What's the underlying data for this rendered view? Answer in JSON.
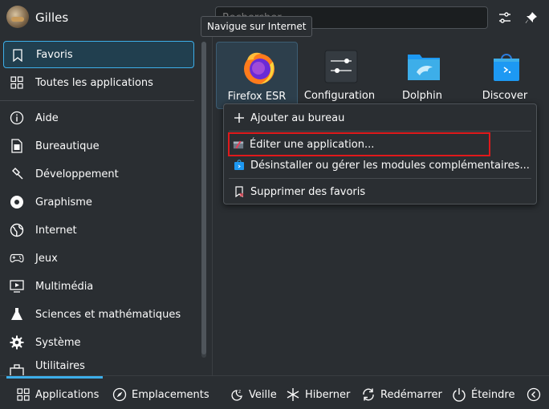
{
  "header": {
    "username": "Gilles",
    "search_placeholder": "Rechercher...",
    "settings_icon": "sliders-icon",
    "pin_icon": "pin-icon"
  },
  "tooltip": "Navigue sur Internet",
  "sidebar": {
    "top_items": [
      {
        "label": "Favoris",
        "icon": "bookmark-icon",
        "active": true
      },
      {
        "label": "Toutes les applications",
        "icon": "grid-icon"
      }
    ],
    "categories": [
      {
        "label": "Aide",
        "icon": "info-icon"
      },
      {
        "label": "Bureautique",
        "icon": "office-icon"
      },
      {
        "label": "Développement",
        "icon": "hammer-icon"
      },
      {
        "label": "Graphisme",
        "icon": "palette-icon"
      },
      {
        "label": "Internet",
        "icon": "globe-icon"
      },
      {
        "label": "Jeux",
        "icon": "gamepad-icon"
      },
      {
        "label": "Multimédia",
        "icon": "media-icon"
      },
      {
        "label": "Sciences et mathématiques",
        "icon": "flask-icon"
      },
      {
        "label": "Système",
        "icon": "gear-icon"
      },
      {
        "label": "Utilitaires",
        "icon": "toolbox-icon"
      }
    ]
  },
  "favorites": [
    {
      "label": "Firefox ESR",
      "icon": "firefox-icon"
    },
    {
      "label": "Configuration",
      "icon": "configuration-icon"
    },
    {
      "label": "Dolphin",
      "icon": "dolphin-folder-icon"
    },
    {
      "label": "Discover",
      "icon": "discover-bag-icon"
    }
  ],
  "context_menu": {
    "items": [
      {
        "label": "Ajouter au bureau",
        "icon": "plus-icon"
      },
      {
        "label": "Éditer une application...",
        "icon": "edit-app-icon",
        "highlighted": true
      },
      {
        "label": "Désinstaller ou gérer les modules complémentaires...",
        "icon": "discover-small-icon"
      },
      {
        "label": "Supprimer des favoris",
        "icon": "remove-bookmark-icon"
      }
    ]
  },
  "footer": {
    "tabs": [
      {
        "label": "Applications",
        "icon": "grid-icon",
        "active": true
      },
      {
        "label": "Emplacements",
        "icon": "compass-icon"
      }
    ],
    "actions": [
      {
        "label": "Veille",
        "icon": "sleep-icon"
      },
      {
        "label": "Hiberner",
        "icon": "snowflake-icon"
      },
      {
        "label": "Redémarrer",
        "icon": "restart-icon"
      },
      {
        "label": "Éteindre",
        "icon": "power-icon"
      }
    ],
    "more_icon": "chevron-left-icon"
  },
  "colors": {
    "accent": "#3daee9",
    "highlight_border": "#e0191b",
    "background": "#2a2e32"
  }
}
